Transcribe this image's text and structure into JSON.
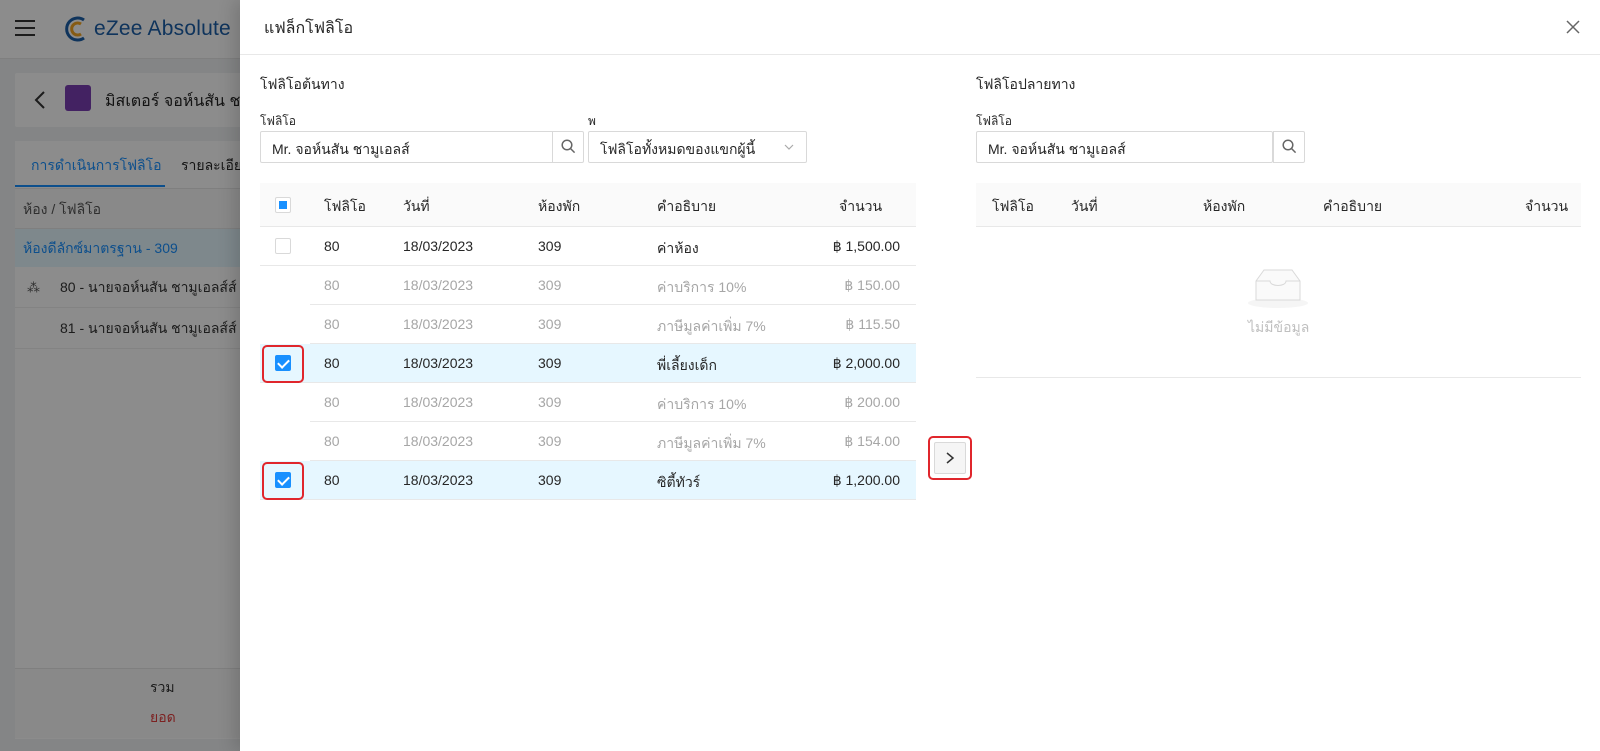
{
  "app": {
    "logo_text": "eZee Absolute"
  },
  "breadcrumb": {
    "title": "มิสเตอร์ จอห์นสัน ชา"
  },
  "left_panel": {
    "tabs": [
      "การดำเนินการโฟลิโอ",
      "รายละเอีย"
    ],
    "header": "ห้อง / โฟลิโอ",
    "group": "ห้องดีลักซ์มาตรฐาน - 309",
    "rows": [
      "80 - นายจอห์นสัน ชามูเอลส์ส์",
      "81 - นายจอห์นสัน ชามูเอลส์ส์"
    ],
    "total_label": "รวม",
    "balance_label": "ยอด"
  },
  "drawer": {
    "title": "แฟล็กโฟลิโอ",
    "source": {
      "section_title": "โฟลิโอต้นทาง",
      "folio_label": "โฟลิโอ",
      "folio_value": "Mr. จอห์นสัน ชามูเอลส์",
      "filter_label": "พ",
      "filter_value": "โฟลิโอทั้งหมดของแขกผู้นี้",
      "columns": [
        "โฟลิโอ",
        "วันที่",
        "ห้องพัก",
        "คำอธิบาย",
        "จำนวน"
      ],
      "rows": [
        {
          "folio": "80",
          "date": "18/03/2023",
          "room": "309",
          "desc": "ค่าห้อง",
          "amount": "฿ 1,500.00",
          "checkbox": true,
          "checked": false,
          "sub": false
        },
        {
          "folio": "80",
          "date": "18/03/2023",
          "room": "309",
          "desc": "ค่าบริการ 10%",
          "amount": "฿ 150.00",
          "checkbox": false,
          "checked": false,
          "sub": true
        },
        {
          "folio": "80",
          "date": "18/03/2023",
          "room": "309",
          "desc": "ภาษีมูลค่าเพิ่ม 7%",
          "amount": "฿ 115.50",
          "checkbox": false,
          "checked": false,
          "sub": true
        },
        {
          "folio": "80",
          "date": "18/03/2023",
          "room": "309",
          "desc": "พี่เลี้ยงเด็ก",
          "amount": "฿ 2,000.00",
          "checkbox": true,
          "checked": true,
          "sub": false
        },
        {
          "folio": "80",
          "date": "18/03/2023",
          "room": "309",
          "desc": "ค่าบริการ 10%",
          "amount": "฿ 200.00",
          "checkbox": false,
          "checked": false,
          "sub": true
        },
        {
          "folio": "80",
          "date": "18/03/2023",
          "room": "309",
          "desc": "ภาษีมูลค่าเพิ่ม 7%",
          "amount": "฿ 154.00",
          "checkbox": false,
          "checked": false,
          "sub": true
        },
        {
          "folio": "80",
          "date": "18/03/2023",
          "room": "309",
          "desc": "ซิตี้ทัวร์",
          "amount": "฿ 1,200.00",
          "checkbox": true,
          "checked": true,
          "sub": false
        }
      ]
    },
    "destination": {
      "section_title": "โฟลิโอปลายทาง",
      "folio_label": "โฟลิโอ",
      "folio_value": "Mr. จอห์นสัน ชามูเอลส์",
      "columns": [
        "โฟลิโอ",
        "วันที่",
        "ห้องพัก",
        "คำอธิบาย",
        "จำนวน"
      ],
      "empty_text": "ไม่มีข้อมูล"
    }
  },
  "colors": {
    "accent": "#1890ff",
    "highlight": "#e0262c",
    "selected_row": "#e6f7ff"
  }
}
